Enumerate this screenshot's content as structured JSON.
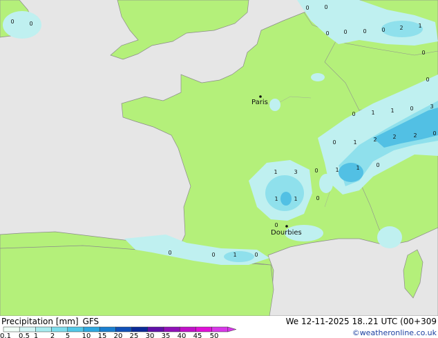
{
  "title": {
    "label": "Precipitation [mm]",
    "model": "GFS"
  },
  "valid": "We 12-11-2025 18..21 UTC (00+309",
  "credit": "©weatheronline.co.uk",
  "cities": [
    {
      "name": "Paris"
    },
    {
      "name": "Dourbies"
    }
  ],
  "precip_labels": [
    "0",
    "0",
    "0",
    "0",
    "0",
    "0",
    "0",
    "2",
    "1",
    "0",
    "0",
    "0",
    "1",
    "0",
    "1",
    "3",
    "0",
    "0",
    "1",
    "2",
    "2",
    "2",
    "0",
    "1",
    "1",
    "0",
    "1",
    "3",
    "0",
    "1",
    "1",
    "0",
    "0",
    "0",
    "0",
    "1",
    "0"
  ],
  "legend": {
    "ticks": [
      "0.1",
      "0.5",
      "1",
      "2",
      "5",
      "10",
      "15",
      "20",
      "25",
      "30",
      "35",
      "40",
      "45",
      "50"
    ],
    "colors": [
      "#f0fff8",
      "#d0f5f5",
      "#a8ecf0",
      "#7cdcec",
      "#52c8e8",
      "#2ea8e0",
      "#1a7fd0",
      "#1050b8",
      "#0a2a98",
      "#6010a8",
      "#9010b8",
      "#c010c8",
      "#e010d8",
      "#d838e8"
    ]
  },
  "colors": {
    "land": "#b4f07a",
    "sea": "#e6e6e6",
    "rain_light": "#bff0f0",
    "rain_mid": "#8fe0ec",
    "rain_heavy": "#52c0e4"
  }
}
